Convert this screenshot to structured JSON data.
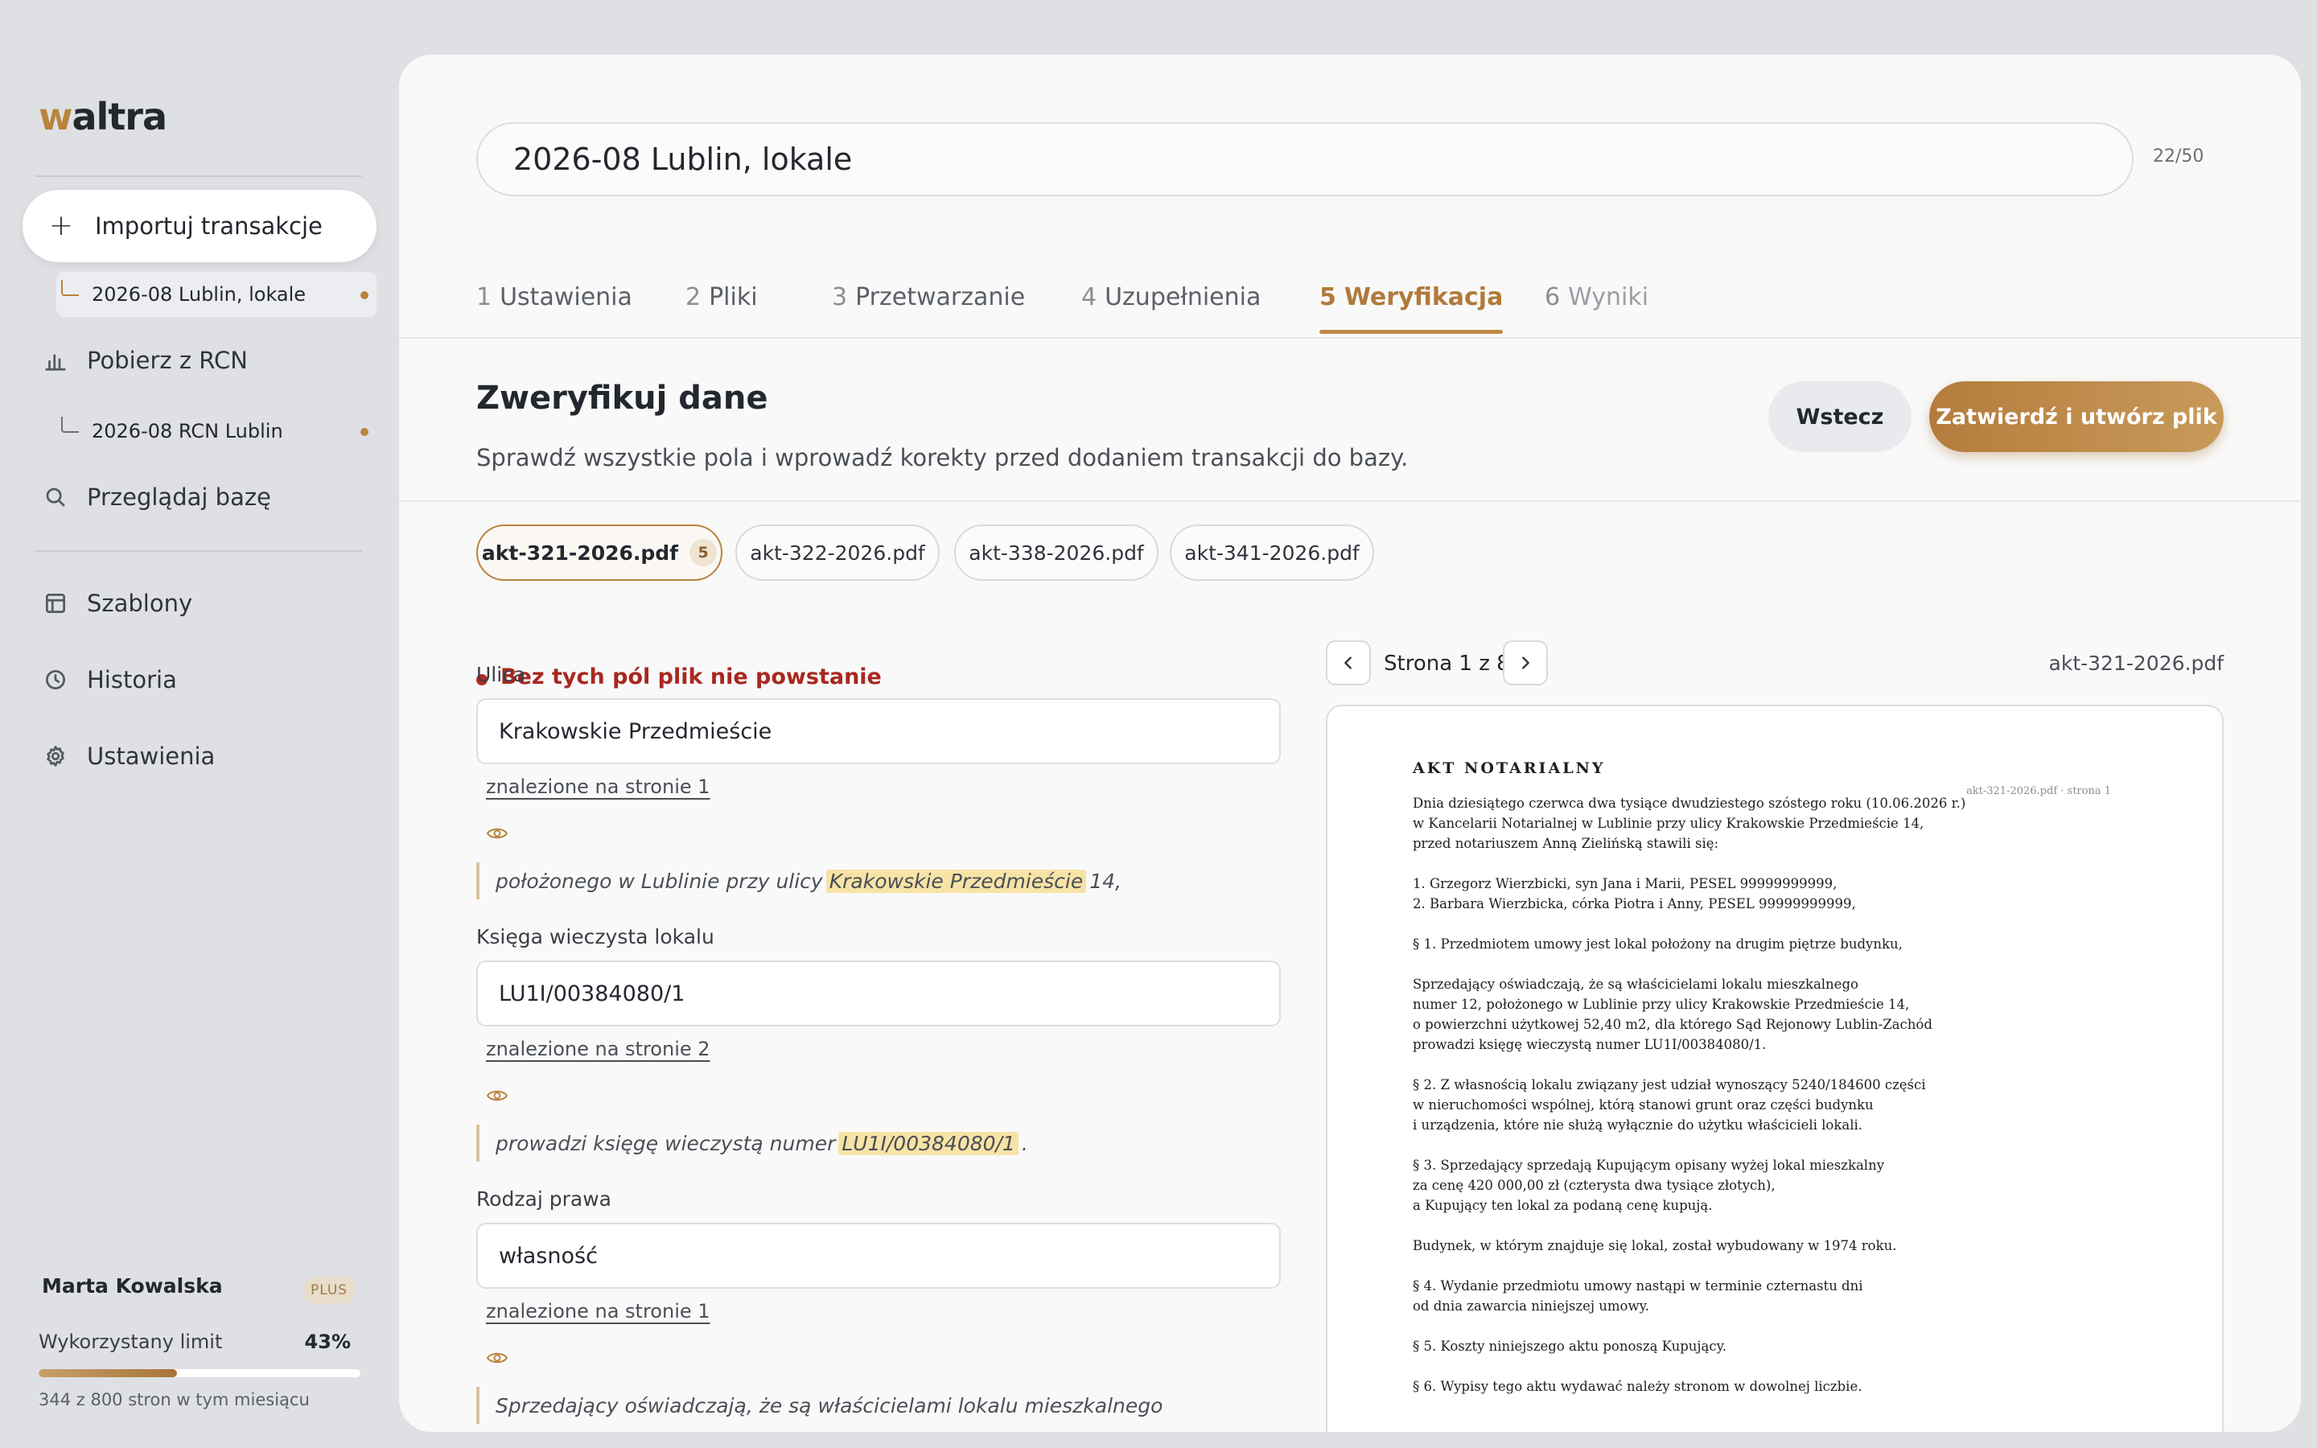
{
  "app": {
    "logo_w": "w",
    "logo_rest": "altra"
  },
  "sidebar": {
    "import_label": "Importuj transakcje",
    "import_icon": "plus-icon",
    "sub_import": "2026-08 Lublin, lokale",
    "rcn_label": "Pobierz z RCN",
    "rcn_icon": "bar-chart-icon",
    "sub_rcn": "2026-08 RCN Lublin",
    "browse_label": "Przeglądaj bazę",
    "browse_icon": "search-icon",
    "templates_label": "Szablony",
    "templates_icon": "template-icon",
    "history_label": "Historia",
    "history_icon": "clock-icon",
    "settings_label": "Ustawienia",
    "settings_icon": "gear-icon",
    "accent": "#b8843e"
  },
  "user": {
    "name": "Marta Kowalska",
    "plan": "PLUS",
    "limit_label": "Wykorzystany limit",
    "limit_pct": "43%",
    "limit_fraction": 0.43,
    "limit_sub": "344 z 800 stron w tym miesiącu"
  },
  "main": {
    "project_title": "2026-08 Lublin, lokale",
    "title_count": "22/50",
    "tabs": [
      {
        "num": "1",
        "label": "Ustawienia"
      },
      {
        "num": "2",
        "label": "Pliki"
      },
      {
        "num": "3",
        "label": "Przetwarzanie"
      },
      {
        "num": "4",
        "label": "Uzupełnienia"
      },
      {
        "num": "5",
        "label": "Weryfikacja"
      },
      {
        "num": "6",
        "label": "Wyniki"
      }
    ],
    "section_title": "Zweryfikuj dane",
    "section_sub": "Sprawdź wszystkie pola i wprowadź korekty przed dodaniem transakcji do bazy.",
    "back_label": "Wstecz",
    "confirm_label": "Zatwierdź i utwórz plik",
    "files": [
      {
        "name": "akt-321-2026.pdf",
        "count": "5"
      },
      {
        "name": "akt-322-2026.pdf"
      },
      {
        "name": "akt-338-2026.pdf"
      },
      {
        "name": "akt-341-2026.pdf"
      }
    ],
    "required_notice": "Bez tych pól plik nie powstanie"
  },
  "fields": [
    {
      "label": "Ulica",
      "value": "Krakowskie Przedmieście",
      "found": "znalezione na stronie 1",
      "quote_pre": "położonego w Lublinie przy ulicy",
      "quote_hl": "Krakowskie Przedmieście",
      "quote_post": "14,"
    },
    {
      "label": "Księga wieczysta lokalu",
      "value": "LU1I/00384080/1",
      "found": "znalezione na stronie 2",
      "quote_pre": "prowadzi księgę wieczystą numer",
      "quote_hl": "LU1I/00384080/1",
      "quote_post": "."
    },
    {
      "label": "Rodzaj prawa",
      "value": "własność",
      "found": "znalezione na stronie 1",
      "quote_pre": "Sprzedający oświadczają, że są właścicielami lokalu mieszkalnego",
      "quote_hl": "",
      "quote_post": ""
    }
  ],
  "viewer": {
    "page_label": "Strona 1 z 8",
    "file_name": "akt-321-2026.pdf",
    "pdf_title": "AKT NOTARIALNY",
    "pdf_meta": "akt-321-2026.pdf · strona 1",
    "pdf_lines": [
      "Dnia dziesiątego czerwca dwa tysiące dwudziestego szóstego roku (10.06.2026 r.)",
      "w Kancelarii Notarialnej w Lublinie przy ulicy Krakowskie Przedmieście 14,",
      "przed notariuszem Anną Zielińską stawili się:",
      "",
      "1. Grzegorz Wierzbicki, syn Jana i Marii, PESEL 99999999999,",
      "2. Barbara Wierzbicka, córka Piotra i Anny, PESEL 99999999999,",
      "",
      "§ 1. Przedmiotem umowy jest lokal położony na drugim piętrze budynku,",
      "",
      "Sprzedający oświadczają, że są właścicielami lokalu mieszkalnego",
      "numer 12, położonego w Lublinie przy ulicy Krakowskie Przedmieście 14,",
      "o powierzchni użytkowej 52,40 m2, dla którego Sąd Rejonowy Lublin-Zachód",
      "prowadzi księgę wieczystą numer LU1I/00384080/1.",
      "",
      "§ 2. Z własnością lokalu związany jest udział wynoszący 5240/184600 części",
      "w nieruchomości wspólnej, którą stanowi grunt oraz części budynku",
      "i urządzenia, które nie służą wyłącznie do użytku właścicieli lokali.",
      "",
      "§ 3. Sprzedający sprzedają Kupującym opisany wyżej lokal mieszkalny",
      "za cenę 420 000,00 zł (czterysta dwa tysiące złotych),",
      "a Kupujący ten lokal za podaną cenę kupują.",
      "",
      "Budynek, w którym znajduje się lokal, został wybudowany w 1974 roku.",
      "",
      "§ 4. Wydanie przedmiotu umowy nastąpi w terminie czternastu dni",
      "od dnia zawarcia niniejszej umowy.",
      "",
      "§ 5. Koszty niniejszego aktu ponoszą Kupujący.",
      "",
      "§ 6. Wypisy tego aktu wydawać należy stronom w dowolnej liczbie."
    ]
  }
}
